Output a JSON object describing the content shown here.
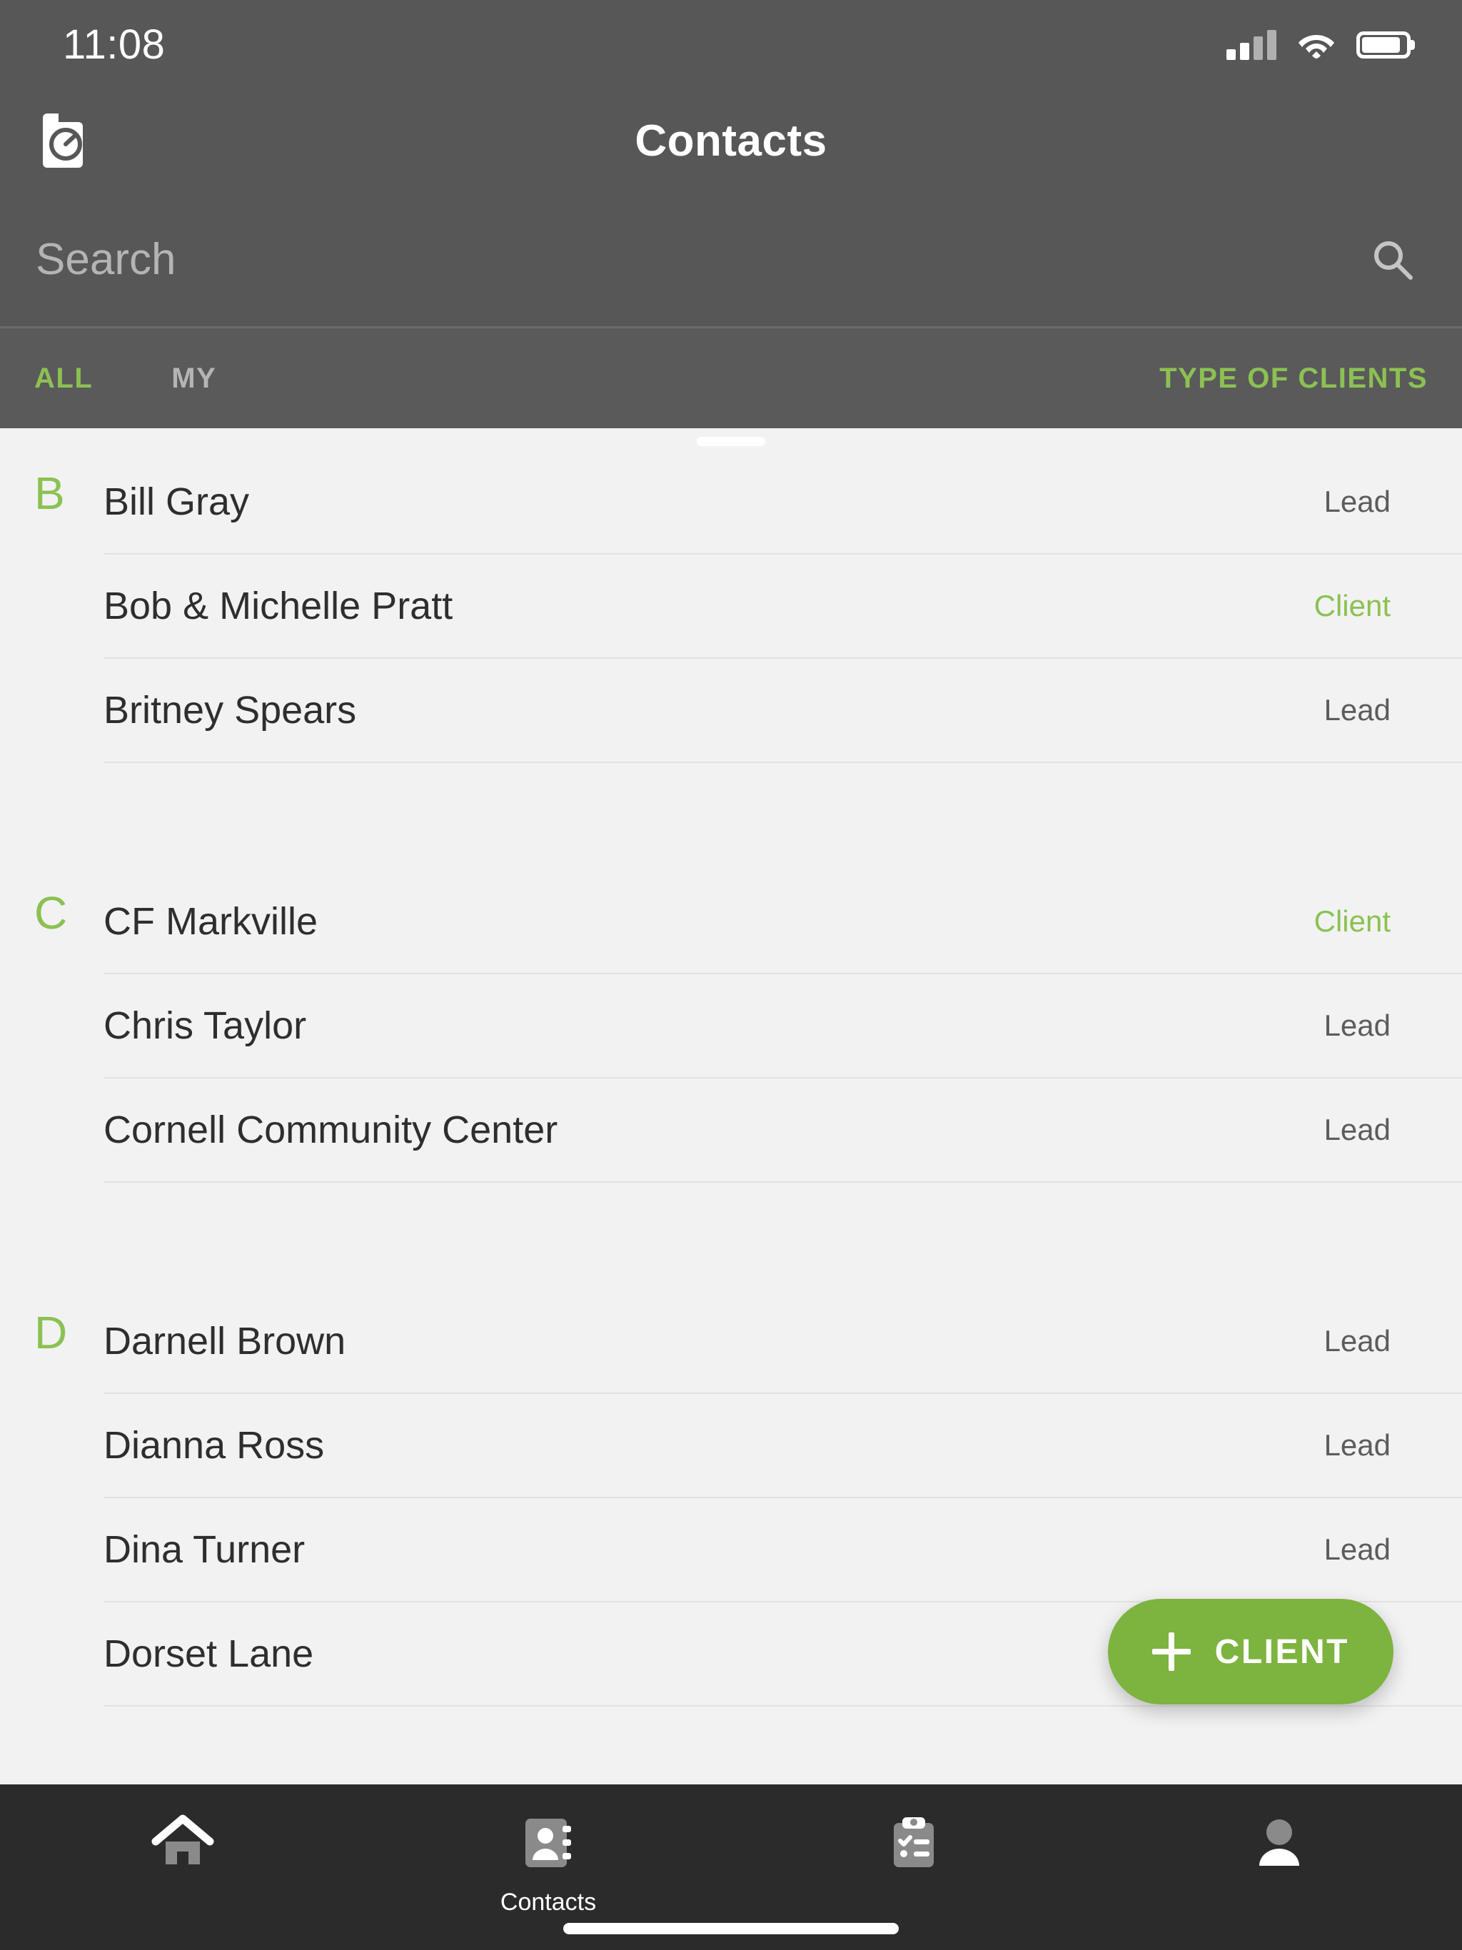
{
  "status_bar": {
    "time": "11:08",
    "signal_icon": "signal-bars-icon",
    "signal_bars_filled": 2,
    "signal_bars_total": 4,
    "wifi_icon": "wifi-icon",
    "battery_icon": "battery-icon",
    "battery_level_percent": 88
  },
  "app_bar": {
    "logo_icon": "brand-logo-icon",
    "title": "Contacts"
  },
  "search": {
    "value": "",
    "placeholder": "Search",
    "icon": "search-icon"
  },
  "filters": {
    "tabs": [
      {
        "label": "ALL",
        "active": true
      },
      {
        "label": "MY",
        "active": false
      }
    ],
    "type_filter_label": "TYPE OF CLIENTS"
  },
  "colors": {
    "accent_green": "#8cc152",
    "fab_green": "#7db33f",
    "header_gray": "#575757",
    "filter_gray": "#5a5a5a",
    "list_background": "#f2f2f2",
    "nav_background": "#2b2b2b",
    "name_text": "#2e2e2e",
    "lead_text": "#5c5c5c"
  },
  "contacts": {
    "groups": [
      {
        "letter": "B",
        "rows": [
          {
            "name": "Bill Gray",
            "status": "Lead",
            "status_type": "lead"
          },
          {
            "name": "Bob & Michelle Pratt",
            "status": "Client",
            "status_type": "client"
          },
          {
            "name": "Britney Spears",
            "status": "Lead",
            "status_type": "lead"
          }
        ]
      },
      {
        "letter": "C",
        "rows": [
          {
            "name": "CF Markville",
            "status": "Client",
            "status_type": "client"
          },
          {
            "name": "Chris Taylor",
            "status": "Lead",
            "status_type": "lead"
          },
          {
            "name": "Cornell Community Center",
            "status": "Lead",
            "status_type": "lead"
          }
        ]
      },
      {
        "letter": "D",
        "rows": [
          {
            "name": "Darnell Brown",
            "status": "Lead",
            "status_type": "lead"
          },
          {
            "name": "Dianna Ross",
            "status": "Lead",
            "status_type": "lead"
          },
          {
            "name": "Dina Turner",
            "status": "Lead",
            "status_type": "lead"
          },
          {
            "name": "Dorset Lane",
            "status": "",
            "status_type": "lead"
          }
        ]
      }
    ]
  },
  "fab": {
    "icon": "plus-icon",
    "label": "CLIENT"
  },
  "bottom_nav": {
    "items": [
      {
        "icon": "home-icon",
        "label": "",
        "active": false
      },
      {
        "icon": "contacts-book-icon",
        "label": "Contacts",
        "active": true
      },
      {
        "icon": "clipboard-tasks-icon",
        "label": "",
        "active": false
      },
      {
        "icon": "person-profile-icon",
        "label": "",
        "active": false
      }
    ]
  }
}
